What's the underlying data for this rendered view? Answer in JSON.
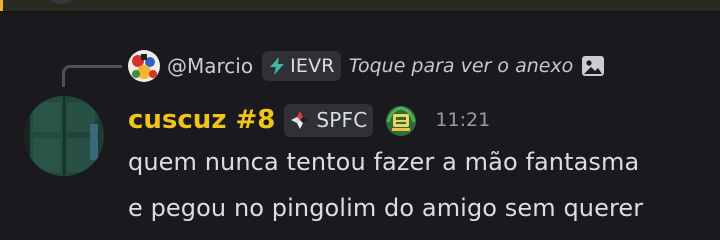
{
  "reply": {
    "author": "@Marcio",
    "tag": "IEVR",
    "preview": "Toque para ver o anexo",
    "attachment_icon": "image-icon"
  },
  "message": {
    "username": "cuscuz #8",
    "username_color": "#f0c419",
    "clan_tag": "SPFC",
    "timestamp": "11:21",
    "lines": [
      "quem nunca tentou fazer a mão fantasma",
      "e pegou no pingolim do amigo sem querer"
    ]
  },
  "colors": {
    "background": "#1a1a1e",
    "tag_background": "#2f3136",
    "text": "#dbdee1",
    "muted_text": "#949ba4",
    "top_accent": "#f0b232"
  }
}
